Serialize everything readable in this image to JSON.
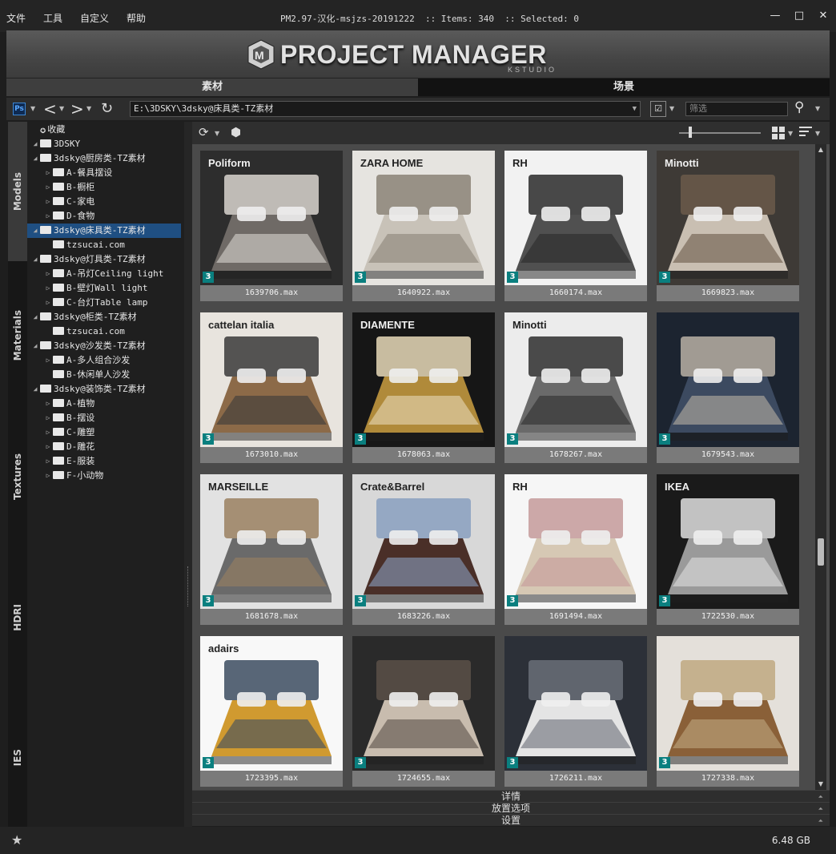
{
  "menu": [
    "文件",
    "工具",
    "自定义",
    "帮助"
  ],
  "window_title": "PM2.97-汉化-msjzs-20191222  :: Items: 340  :: Selected: 0",
  "window_buttons": {
    "close": "✕",
    "maximize": "□",
    "minimize": "—"
  },
  "banner": {
    "title": "PROJECT MANAGER",
    "subtitle": "KSTUDIO"
  },
  "category_tabs": [
    {
      "label": "素材",
      "active": true
    },
    {
      "label": "场景",
      "active": false
    }
  ],
  "toolbar": {
    "path": "E:\\3DSKY\\3dsky@床具类-TZ素材",
    "filter_placeholder": "筛选",
    "ps_label": "Ps"
  },
  "side_tabs": [
    "Models",
    "Materials",
    "Textures",
    "HDRI",
    "IES"
  ],
  "tree": [
    {
      "label": "收藏",
      "level": 0,
      "icon": "star",
      "expander": ""
    },
    {
      "label": "3DSKY",
      "level": 0,
      "icon": "folder",
      "expander": "◢"
    },
    {
      "label": "3dsky@厨房类-TZ素材",
      "level": 1,
      "icon": "folder",
      "expander": "◢"
    },
    {
      "label": "A-餐具摆设",
      "level": 2,
      "icon": "folder",
      "expander": "▷"
    },
    {
      "label": "B-橱柜",
      "level": 2,
      "icon": "folder",
      "expander": "▷"
    },
    {
      "label": "C-家电",
      "level": 2,
      "icon": "folder",
      "expander": "▷"
    },
    {
      "label": "D-食物",
      "level": 2,
      "icon": "folder",
      "expander": "▷"
    },
    {
      "label": "3dsky@床具类-TZ素材",
      "level": 1,
      "icon": "folder",
      "expander": "◢",
      "selected": true
    },
    {
      "label": "tzsucai.com",
      "level": 2,
      "icon": "folder",
      "expander": ""
    },
    {
      "label": "3dsky@灯具类-TZ素材",
      "level": 1,
      "icon": "folder",
      "expander": "◢"
    },
    {
      "label": "A-吊灯Ceiling light",
      "level": 2,
      "icon": "folder",
      "expander": "▷"
    },
    {
      "label": "B-壁灯Wall light",
      "level": 2,
      "icon": "folder",
      "expander": "▷"
    },
    {
      "label": "C-台灯Table lamp",
      "level": 2,
      "icon": "folder",
      "expander": "▷"
    },
    {
      "label": "3dsky@柜类-TZ素材",
      "level": 1,
      "icon": "folder",
      "expander": "◢"
    },
    {
      "label": "tzsucai.com",
      "level": 2,
      "icon": "folder",
      "expander": ""
    },
    {
      "label": "3dsky@沙发类-TZ素材",
      "level": 1,
      "icon": "folder",
      "expander": "◢"
    },
    {
      "label": "A-多人组合沙发",
      "level": 2,
      "icon": "folder",
      "expander": "▷"
    },
    {
      "label": "B-休闲单人沙发",
      "level": 2,
      "icon": "folder",
      "expander": ""
    },
    {
      "label": "3dsky@装饰类-TZ素材",
      "level": 1,
      "icon": "folder",
      "expander": "◢"
    },
    {
      "label": "A-植物",
      "level": 2,
      "icon": "folder",
      "expander": "▷"
    },
    {
      "label": "B-摆设",
      "level": 2,
      "icon": "folder",
      "expander": "▷"
    },
    {
      "label": "C-雕塑",
      "level": 2,
      "icon": "folder",
      "expander": "▷"
    },
    {
      "label": "D-雕花",
      "level": 2,
      "icon": "folder",
      "expander": "▷"
    },
    {
      "label": "E-服装",
      "level": 2,
      "icon": "folder",
      "expander": "▷"
    },
    {
      "label": "F-小动物",
      "level": 2,
      "icon": "folder",
      "expander": "▷"
    }
  ],
  "thumbnails": [
    {
      "file": "1639706.max",
      "brand": "Poliform"
    },
    {
      "file": "1640922.max",
      "brand": "ZARA HOME"
    },
    {
      "file": "1660174.max",
      "brand": "RH"
    },
    {
      "file": "1669823.max",
      "brand": "Minotti"
    },
    {
      "file": "1673010.max",
      "brand": "cattelan italia"
    },
    {
      "file": "1678063.max",
      "brand": "DIAMENTE"
    },
    {
      "file": "1678267.max",
      "brand": "Minotti"
    },
    {
      "file": "1679543.max",
      "brand": ""
    },
    {
      "file": "1681678.max",
      "brand": "MARSEILLE"
    },
    {
      "file": "1683226.max",
      "brand": "Crate&Barrel"
    },
    {
      "file": "1691494.max",
      "brand": "RH"
    },
    {
      "file": "1722530.max",
      "brand": "IKEA"
    },
    {
      "file": "1723395.max",
      "brand": "adairs"
    },
    {
      "file": "1724655.max",
      "brand": ""
    },
    {
      "file": "1726211.max",
      "brand": ""
    },
    {
      "file": "1727338.max",
      "brand": ""
    }
  ],
  "accordion": [
    "详情",
    "放置选项",
    "设置"
  ],
  "footer": {
    "disk_size": "6.48 GB"
  }
}
